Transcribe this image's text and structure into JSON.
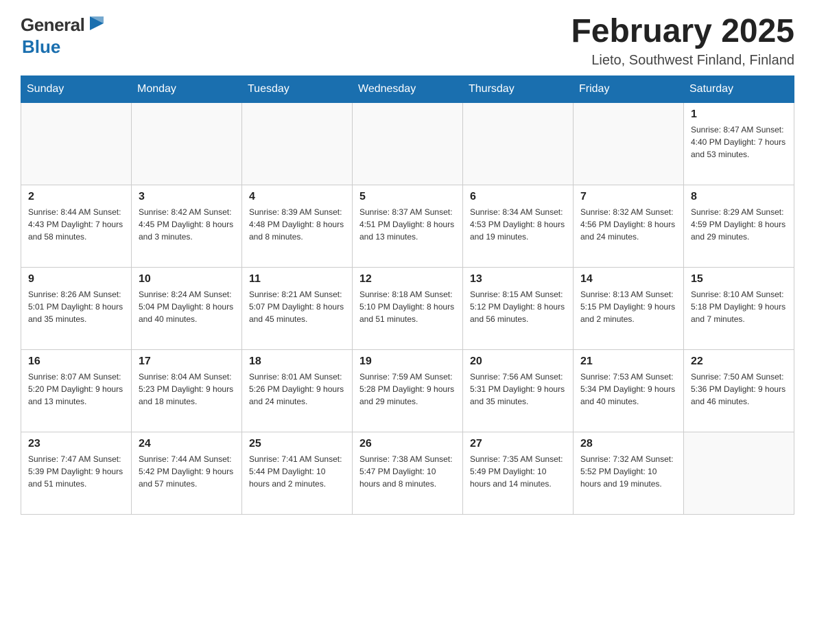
{
  "header": {
    "title": "February 2025",
    "subtitle": "Lieto, Southwest Finland, Finland",
    "logo_general": "General",
    "logo_blue": "Blue"
  },
  "days_of_week": [
    "Sunday",
    "Monday",
    "Tuesday",
    "Wednesday",
    "Thursday",
    "Friday",
    "Saturday"
  ],
  "weeks": [
    [
      {
        "day": "",
        "info": ""
      },
      {
        "day": "",
        "info": ""
      },
      {
        "day": "",
        "info": ""
      },
      {
        "day": "",
        "info": ""
      },
      {
        "day": "",
        "info": ""
      },
      {
        "day": "",
        "info": ""
      },
      {
        "day": "1",
        "info": "Sunrise: 8:47 AM\nSunset: 4:40 PM\nDaylight: 7 hours\nand 53 minutes."
      }
    ],
    [
      {
        "day": "2",
        "info": "Sunrise: 8:44 AM\nSunset: 4:43 PM\nDaylight: 7 hours\nand 58 minutes."
      },
      {
        "day": "3",
        "info": "Sunrise: 8:42 AM\nSunset: 4:45 PM\nDaylight: 8 hours\nand 3 minutes."
      },
      {
        "day": "4",
        "info": "Sunrise: 8:39 AM\nSunset: 4:48 PM\nDaylight: 8 hours\nand 8 minutes."
      },
      {
        "day": "5",
        "info": "Sunrise: 8:37 AM\nSunset: 4:51 PM\nDaylight: 8 hours\nand 13 minutes."
      },
      {
        "day": "6",
        "info": "Sunrise: 8:34 AM\nSunset: 4:53 PM\nDaylight: 8 hours\nand 19 minutes."
      },
      {
        "day": "7",
        "info": "Sunrise: 8:32 AM\nSunset: 4:56 PM\nDaylight: 8 hours\nand 24 minutes."
      },
      {
        "day": "8",
        "info": "Sunrise: 8:29 AM\nSunset: 4:59 PM\nDaylight: 8 hours\nand 29 minutes."
      }
    ],
    [
      {
        "day": "9",
        "info": "Sunrise: 8:26 AM\nSunset: 5:01 PM\nDaylight: 8 hours\nand 35 minutes."
      },
      {
        "day": "10",
        "info": "Sunrise: 8:24 AM\nSunset: 5:04 PM\nDaylight: 8 hours\nand 40 minutes."
      },
      {
        "day": "11",
        "info": "Sunrise: 8:21 AM\nSunset: 5:07 PM\nDaylight: 8 hours\nand 45 minutes."
      },
      {
        "day": "12",
        "info": "Sunrise: 8:18 AM\nSunset: 5:10 PM\nDaylight: 8 hours\nand 51 minutes."
      },
      {
        "day": "13",
        "info": "Sunrise: 8:15 AM\nSunset: 5:12 PM\nDaylight: 8 hours\nand 56 minutes."
      },
      {
        "day": "14",
        "info": "Sunrise: 8:13 AM\nSunset: 5:15 PM\nDaylight: 9 hours\nand 2 minutes."
      },
      {
        "day": "15",
        "info": "Sunrise: 8:10 AM\nSunset: 5:18 PM\nDaylight: 9 hours\nand 7 minutes."
      }
    ],
    [
      {
        "day": "16",
        "info": "Sunrise: 8:07 AM\nSunset: 5:20 PM\nDaylight: 9 hours\nand 13 minutes."
      },
      {
        "day": "17",
        "info": "Sunrise: 8:04 AM\nSunset: 5:23 PM\nDaylight: 9 hours\nand 18 minutes."
      },
      {
        "day": "18",
        "info": "Sunrise: 8:01 AM\nSunset: 5:26 PM\nDaylight: 9 hours\nand 24 minutes."
      },
      {
        "day": "19",
        "info": "Sunrise: 7:59 AM\nSunset: 5:28 PM\nDaylight: 9 hours\nand 29 minutes."
      },
      {
        "day": "20",
        "info": "Sunrise: 7:56 AM\nSunset: 5:31 PM\nDaylight: 9 hours\nand 35 minutes."
      },
      {
        "day": "21",
        "info": "Sunrise: 7:53 AM\nSunset: 5:34 PM\nDaylight: 9 hours\nand 40 minutes."
      },
      {
        "day": "22",
        "info": "Sunrise: 7:50 AM\nSunset: 5:36 PM\nDaylight: 9 hours\nand 46 minutes."
      }
    ],
    [
      {
        "day": "23",
        "info": "Sunrise: 7:47 AM\nSunset: 5:39 PM\nDaylight: 9 hours\nand 51 minutes."
      },
      {
        "day": "24",
        "info": "Sunrise: 7:44 AM\nSunset: 5:42 PM\nDaylight: 9 hours\nand 57 minutes."
      },
      {
        "day": "25",
        "info": "Sunrise: 7:41 AM\nSunset: 5:44 PM\nDaylight: 10 hours\nand 2 minutes."
      },
      {
        "day": "26",
        "info": "Sunrise: 7:38 AM\nSunset: 5:47 PM\nDaylight: 10 hours\nand 8 minutes."
      },
      {
        "day": "27",
        "info": "Sunrise: 7:35 AM\nSunset: 5:49 PM\nDaylight: 10 hours\nand 14 minutes."
      },
      {
        "day": "28",
        "info": "Sunrise: 7:32 AM\nSunset: 5:52 PM\nDaylight: 10 hours\nand 19 minutes."
      },
      {
        "day": "",
        "info": ""
      }
    ]
  ]
}
